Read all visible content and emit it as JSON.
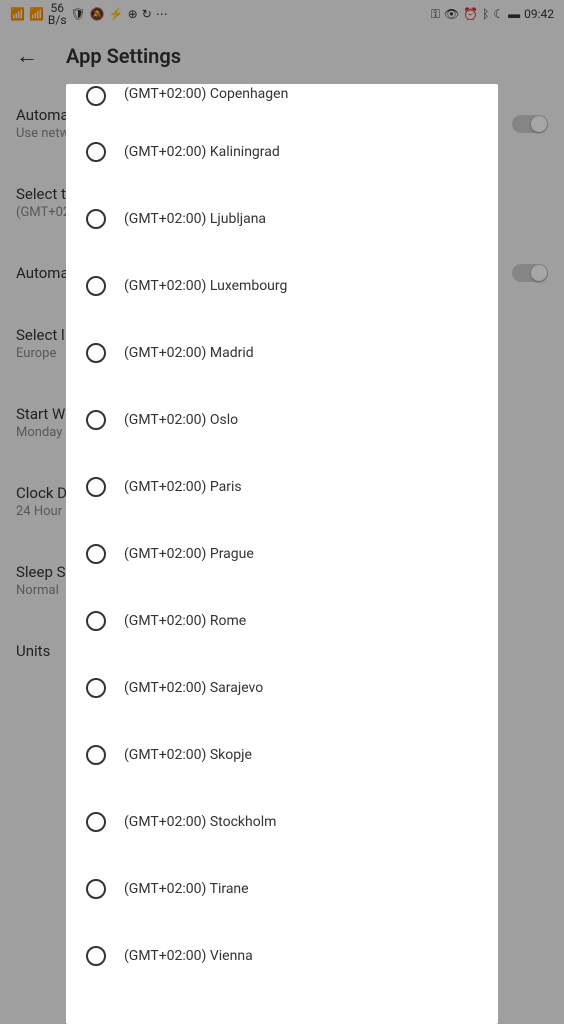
{
  "status_bar": {
    "speed_num": "56",
    "speed_unit": "B/s",
    "time": "09:42"
  },
  "header": {
    "title": "App Settings"
  },
  "settings": {
    "auto_time": {
      "title": "Automa",
      "subtitle": "Use netw"
    },
    "select_tz": {
      "title": "Select t",
      "subtitle": "(GMT+02"
    },
    "auto_loc": {
      "title": "Automa"
    },
    "select_loc": {
      "title": "Select l",
      "subtitle": "Europe"
    },
    "start_week": {
      "title": "Start W",
      "subtitle": "Monday"
    },
    "clock": {
      "title": "Clock D",
      "subtitle": "24 Hour"
    },
    "sleep": {
      "title": "Sleep S",
      "subtitle": "Normal"
    },
    "units": {
      "title": "Units"
    }
  },
  "timezones": [
    {
      "label": "(GMT+02:00) Copenhagen"
    },
    {
      "label": "(GMT+02:00) Kaliningrad"
    },
    {
      "label": "(GMT+02:00) Ljubljana"
    },
    {
      "label": "(GMT+02:00) Luxembourg"
    },
    {
      "label": "(GMT+02:00) Madrid"
    },
    {
      "label": "(GMT+02:00) Oslo"
    },
    {
      "label": "(GMT+02:00) Paris"
    },
    {
      "label": "(GMT+02:00) Prague"
    },
    {
      "label": "(GMT+02:00) Rome"
    },
    {
      "label": "(GMT+02:00) Sarajevo"
    },
    {
      "label": "(GMT+02:00) Skopje"
    },
    {
      "label": "(GMT+02:00) Stockholm"
    },
    {
      "label": "(GMT+02:00) Tirane"
    },
    {
      "label": "(GMT+02:00) Vienna"
    }
  ]
}
